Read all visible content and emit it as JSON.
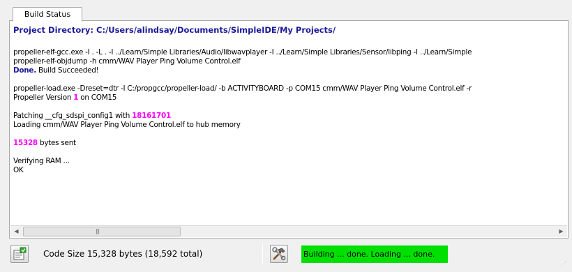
{
  "tab": {
    "label": "Build Status"
  },
  "console": {
    "header": "Project Directory: C:/Users/alindsay/Documents/SimpleIDE/My Projects/",
    "compile_cmd": "propeller-elf-gcc.exe -I . -L . -I ../Learn/Simple Libraries/Audio/libwavplayer -I ../Learn/Simple Libraries/Sensor/libping -I ../Learn/Simple",
    "objdump_cmd": "propeller-elf-objdump -h cmm/WAV Player Ping Volume Control.elf",
    "done_label": "Done.",
    "build_result": "Build Succeeded!",
    "load_cmd": "propeller-load.exe -Dreset=dtr -I C:/propgcc/propeller-load/ -b ACTIVITYBOARD -p COM15 cmm/WAV Player Ping Volume Control.elf -r",
    "version_prefix": "Propeller Version",
    "version_number": "1",
    "version_suffix": "on COM15",
    "patch_prefix": "Patching __cfg_sdspi_config1 with",
    "patch_value": "18161701",
    "loading_line": "Loading cmm/WAV Player Ping Volume Control.elf to hub memory",
    "bytes_sent_value": "15328",
    "bytes_sent_label": "bytes sent",
    "verify_line": "Verifying RAM ...",
    "ok_line": "OK"
  },
  "scrollbar": {
    "left_arrow": "◀",
    "right_arrow": "▶",
    "grip": "|||"
  },
  "status_bar": {
    "code_size_text": "Code Size 15,328 bytes (18,592 total)",
    "progress_text": "Building ... done. Loading ... done.",
    "progress_color": "#00e000",
    "code_size_icon": "code-size-icon",
    "build_icon": "hammer-wrench-icon"
  }
}
